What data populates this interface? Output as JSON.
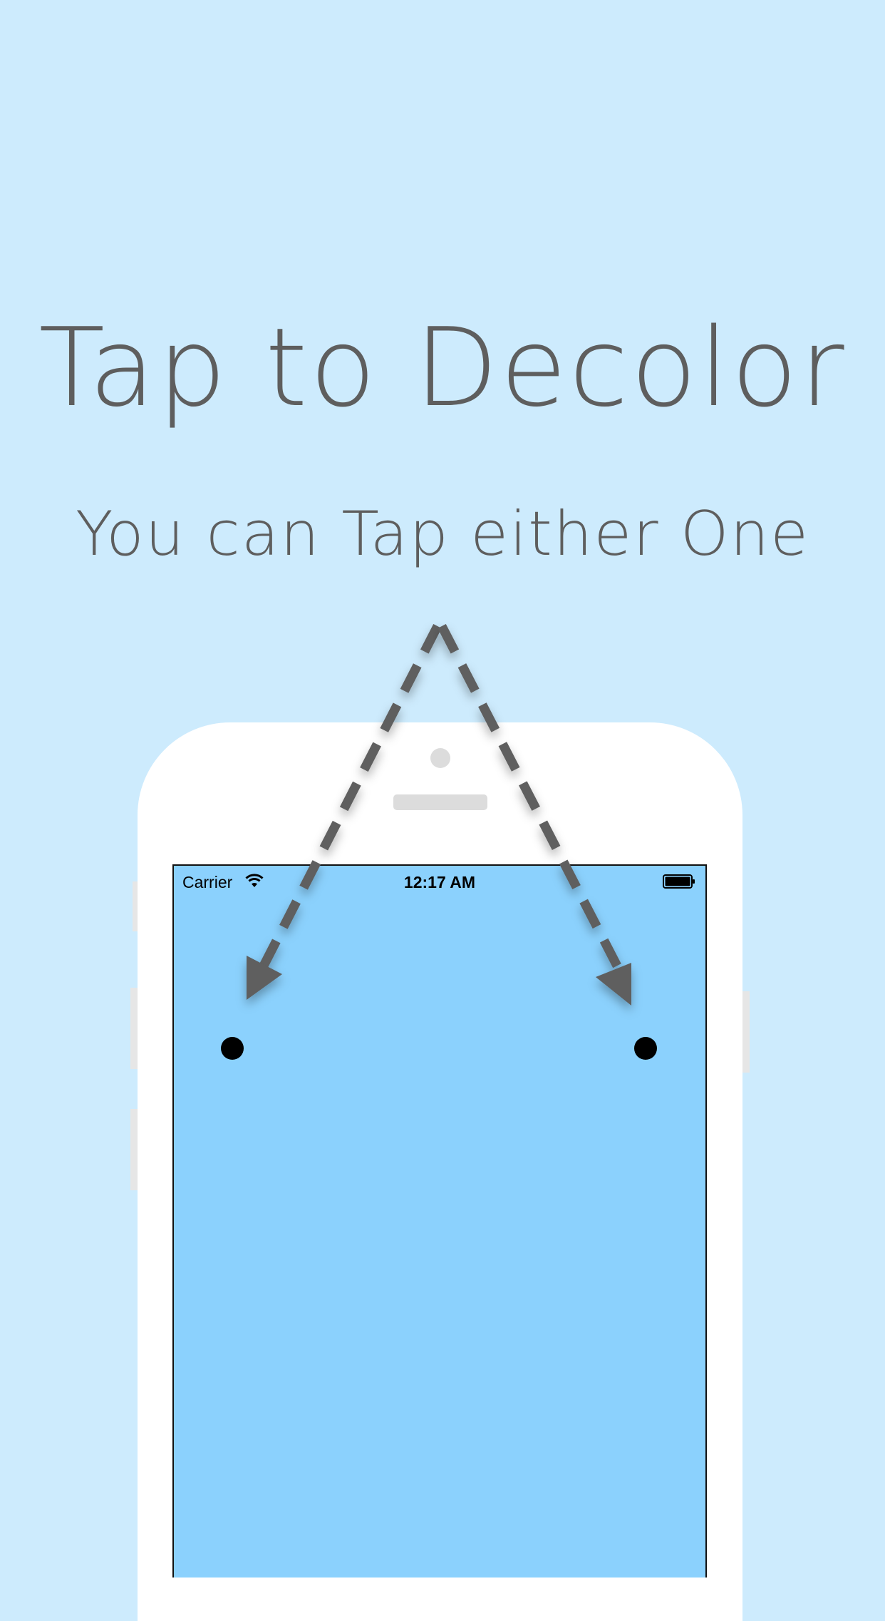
{
  "headline": "Tap to Decolor",
  "subhead": "You can Tap either One",
  "status_bar": {
    "carrier": "Carrier",
    "time": "12:17 AM"
  },
  "colors": {
    "background": "#cdebfd",
    "screen": "#8bd1fd",
    "text": "#5e5e5e",
    "arrow": "#5e5e5e",
    "phone_body": "#ffffff",
    "tap_dot": "#000000"
  },
  "icons": [
    "wifi-icon",
    "battery-icon",
    "arrow-down-left",
    "arrow-down-right"
  ]
}
